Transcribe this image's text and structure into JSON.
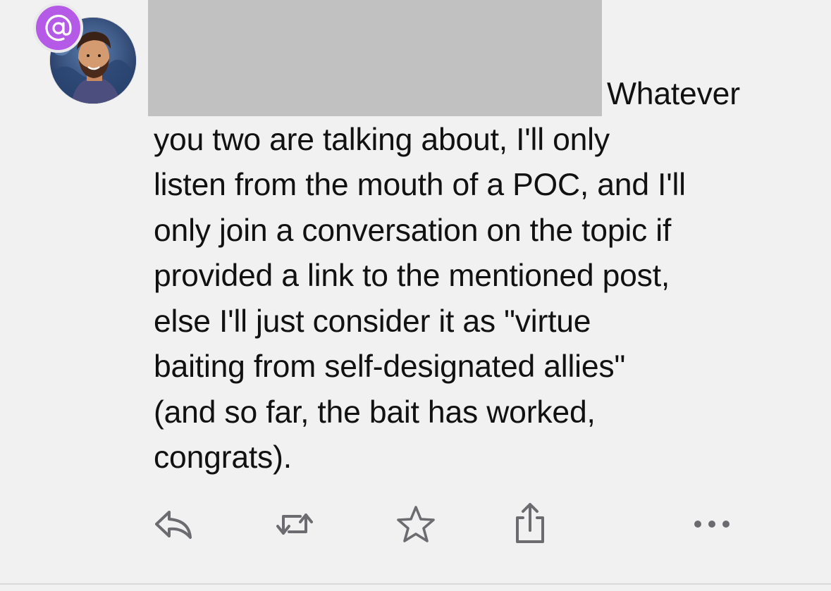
{
  "post": {
    "lines": [
      "Whatever",
      "you two are talking about, I'll only",
      "listen from the mouth of a POC, and I'll",
      "only join a conversation on the topic if",
      "provided a link to the mentioned post,",
      "else I'll just consider it as \"virtue",
      "baiting from self-designated allies\"",
      "(and so far, the bait has worked,",
      "congrats)."
    ],
    "mention_badge": "@",
    "author_redacted": true
  },
  "actions": [
    {
      "name": "reply",
      "icon": "reply-icon"
    },
    {
      "name": "boost",
      "icon": "boost-icon"
    },
    {
      "name": "favourite",
      "icon": "star-icon"
    },
    {
      "name": "share",
      "icon": "share-icon"
    },
    {
      "name": "more",
      "icon": "more-icon"
    }
  ],
  "colors": {
    "background": "#f1f1f2",
    "text": "#111111",
    "icon": "#6b6b70",
    "mention_badge": "#b45ae6",
    "redaction": "#c1c1c1"
  }
}
